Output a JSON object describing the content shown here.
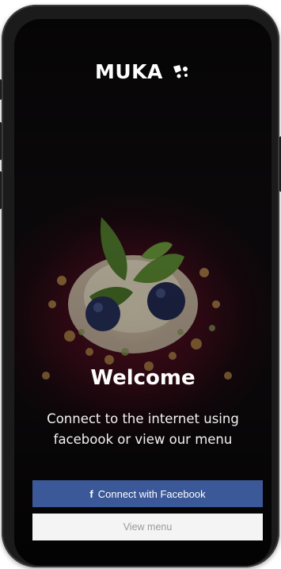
{
  "brand": {
    "name": "MUKA",
    "logo_icon": "paw-drop-icon"
  },
  "welcome": {
    "title": "Welcome",
    "subtitle": "Connect to the internet using facebook or view our menu"
  },
  "actions": {
    "facebook_label": "Connect with Facebook",
    "facebook_icon": "facebook-f-icon",
    "facebook_color": "#3b5998",
    "menu_label": "View menu",
    "menu_color": "#f4f4f4"
  }
}
